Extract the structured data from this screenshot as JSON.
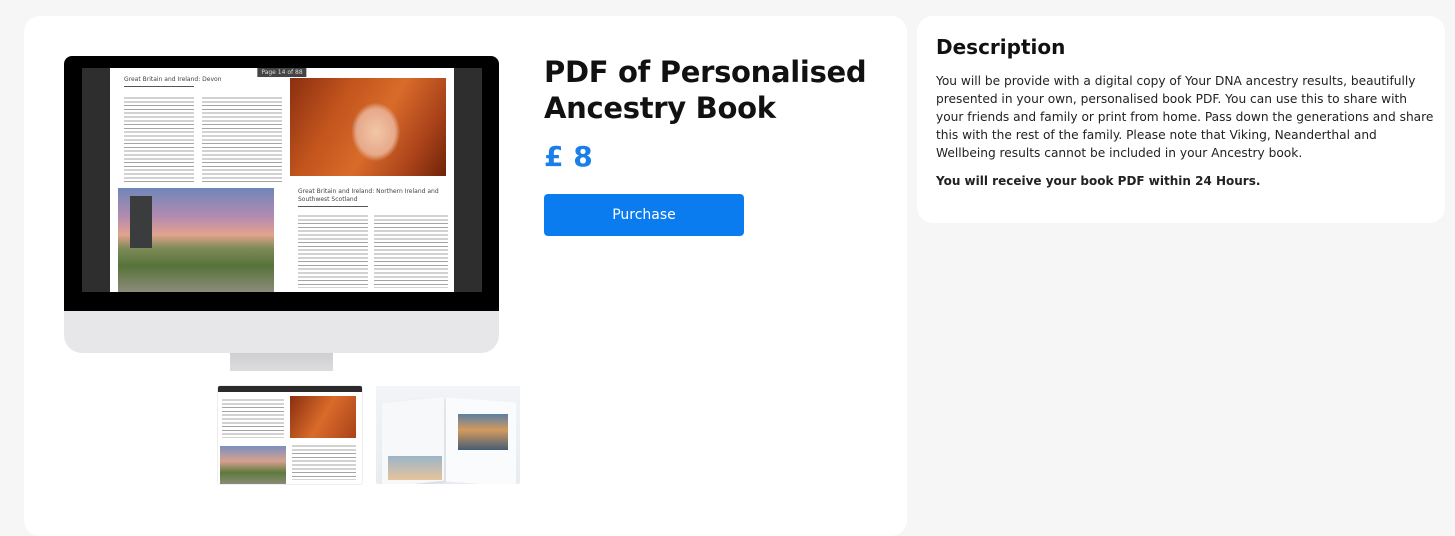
{
  "product": {
    "title": "PDF of Personalised Ancestry Book",
    "price": "£ 8",
    "purchase_label": "Purchase"
  },
  "preview": {
    "page_indicator": "Page 14 of 88",
    "heading_left": "Great Britain and Ireland: Devon",
    "heading_right": "Great Britain and Ireland: Northern Ireland and Southwest Scotland"
  },
  "description": {
    "title": "Description",
    "body": "You will be provide with a digital copy of Your DNA ancestry results, beautifully presented in your own, personalised book PDF. You can use this to share with your friends and family or print from home. Pass down the generations and share this with the rest of the family. Please note that Viking, Neanderthal and Wellbeing results cannot be included in your Ancestry book.",
    "note": "You will receive your book PDF within 24 Hours."
  },
  "colors": {
    "accent": "#0a7cf0",
    "price": "#1a7fe8",
    "background": "#f6f6f6"
  }
}
